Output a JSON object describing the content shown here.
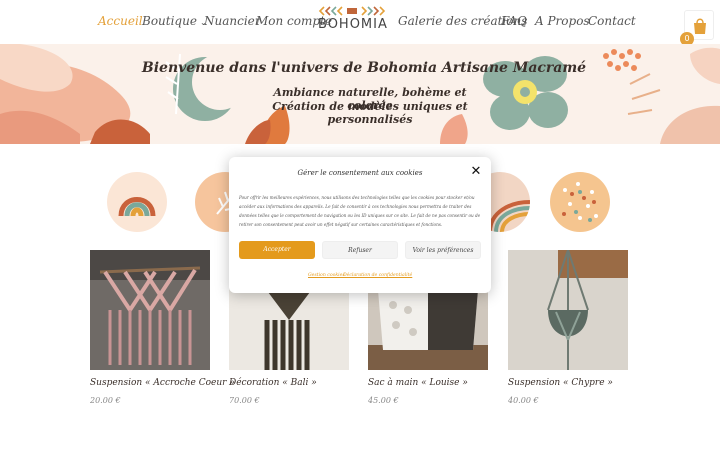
{
  "header": {
    "nav": {
      "home": "Accueil",
      "shop": "Boutique",
      "colors": "Nuancier",
      "account": "Mon compte",
      "gallery": "Galerie des créations",
      "faq": "FAQ",
      "about": "A Propos",
      "contact": "Contact"
    },
    "logo_text": "BOHOMIA",
    "cart_count": "0",
    "accent_color": "#e4a13a"
  },
  "hero": {
    "title": "Bienvenue dans l'univers de Bohomia Artisane Macramé",
    "subtitle_1": "Ambiance naturelle, bohème et colorée",
    "subtitle_2": "Création de modèles uniques et personnalisés"
  },
  "categories": [
    {
      "icon": "rainbow-icon"
    },
    {
      "icon": "leaf-icon"
    },
    {
      "icon": "rainbow-stripes-icon"
    },
    {
      "icon": "dots-icon"
    }
  ],
  "products": [
    {
      "name": "Suspension « Accroche Coeur »",
      "price": "20.00 €"
    },
    {
      "name": "Décoration « Bali »",
      "price": "70.00 €"
    },
    {
      "name": "Sac à main « Louise »",
      "price": "45.00 €"
    },
    {
      "name": "Suspension « Chypre »",
      "price": "40.00 €"
    }
  ],
  "cookie_modal": {
    "title": "Gérer le consentement aux cookies",
    "body": "Pour offrir les meilleures expériences, nous utilisons des technologies telles que les cookies pour stocker et/ou accéder aux informations des appareils. Le fait de consentir à ces technologies nous permettra de traiter des données telles que le comportement de navigation ou les ID uniques sur ce site. Le fait de ne pas consentir ou de retirer son consentement peut avoir un effet négatif sur certaines caractéristiques et fonctions.",
    "accept_label": "Accepter",
    "refuse_label": "Refuser",
    "prefs_label": "Voir les préférences",
    "link_cookies": "Gestion cookies",
    "link_privacy": "Déclaration de confidentialité",
    "accept_color": "#e49a1c"
  }
}
